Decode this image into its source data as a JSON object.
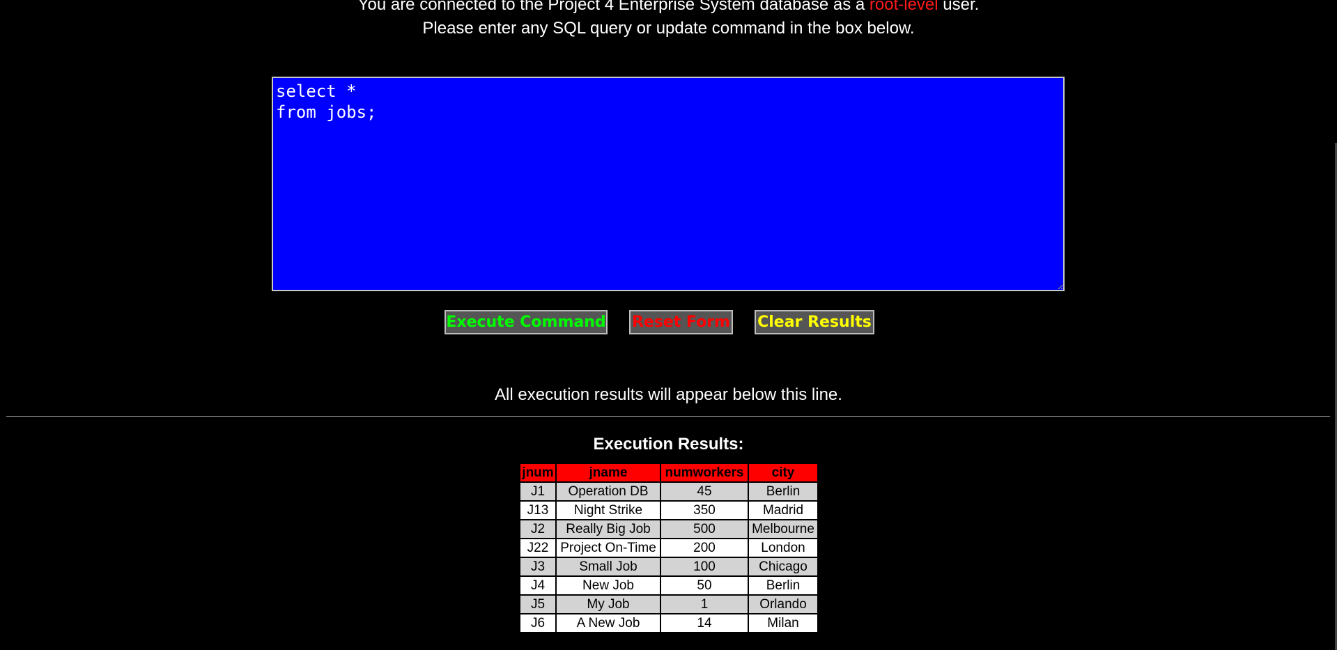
{
  "intro": {
    "line1_before": "You are connected to the Project 4 Enterprise System database as a ",
    "line1_highlight": "root-level",
    "line1_after": " user.",
    "line2": "Please enter any SQL query or update command in the box below."
  },
  "query": {
    "value": "select *\nfrom jobs;"
  },
  "buttons": {
    "execute": "Execute Command",
    "reset": "Reset Form",
    "clear": "Clear Results"
  },
  "results": {
    "note": "All execution results will appear below this line.",
    "title": "Execution Results:",
    "columns": [
      "jnum",
      "jname",
      "numworkers",
      "city"
    ],
    "rows": [
      [
        "J1",
        "Operation DB",
        "45",
        "Berlin"
      ],
      [
        "J13",
        "Night Strike",
        "350",
        "Madrid"
      ],
      [
        "J2",
        "Really Big Job",
        "500",
        "Melbourne"
      ],
      [
        "J22",
        "Project On-Time",
        "200",
        "London"
      ],
      [
        "J3",
        "Small Job",
        "100",
        "Chicago"
      ],
      [
        "J4",
        "New Job",
        "50",
        "Berlin"
      ],
      [
        "J5",
        "My Job",
        "1",
        "Orlando"
      ],
      [
        "J6",
        "A New Job",
        "14",
        "Milan"
      ]
    ]
  },
  "colors": {
    "background": "#000000",
    "textarea_bg": "#0000ff",
    "header_bg": "#ff0000",
    "highlight_text": "#ff1a1a",
    "execute_text": "#00ff00",
    "reset_text": "#ff0000",
    "clear_text": "#ffff00",
    "button_bg": "#555555",
    "row_alt_bg": "#d3d3d3"
  }
}
